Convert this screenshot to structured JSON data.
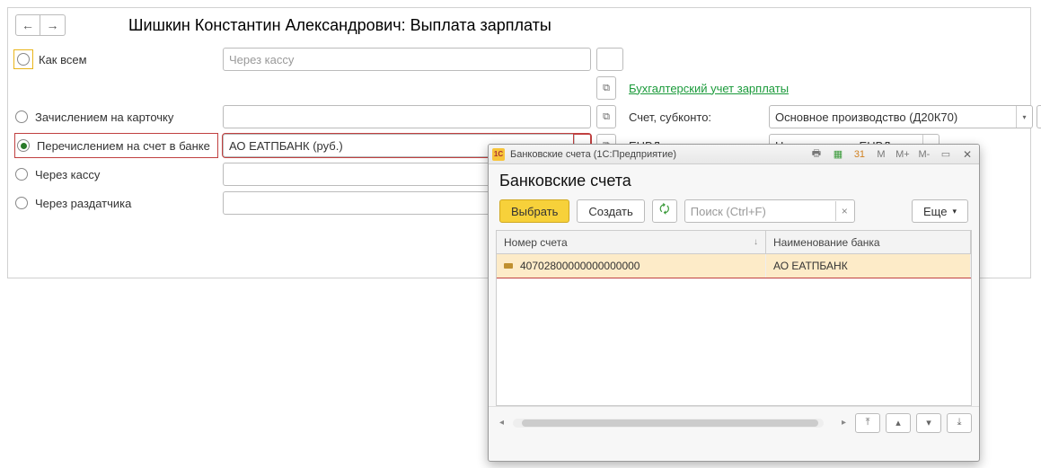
{
  "header": {
    "title": "Шишкин Константин Александрович: Выплата зарплаты"
  },
  "payment_options": [
    {
      "label": "Как всем",
      "selected": false,
      "highlight": true
    },
    {
      "label": "Зачислением на карточку",
      "selected": false
    },
    {
      "label": "Перечислением на счет в банке",
      "selected": true,
      "bank_row": true
    },
    {
      "label": "Через кассу",
      "selected": false
    },
    {
      "label": "Через раздатчика",
      "selected": false
    }
  ],
  "fields": {
    "through_cashier_placeholder": "Через кассу",
    "bank_value": "АО ЕАТПБАНК (руб.)"
  },
  "right_panel": {
    "link": "Бухгалтерский учет зарплаты",
    "account_label": "Счет, субконто:",
    "account_value": "Основное производство (Д20К70)",
    "envd_label": "ЕНВД:",
    "envd_value": "Не относится к ЕНВД"
  },
  "popup": {
    "titlebar": "Банковские счета  (1С:Предприятие)",
    "heading": "Банковские счета",
    "buttons": {
      "select": "Выбрать",
      "create": "Создать",
      "more": "Еще"
    },
    "search_placeholder": "Поиск (Ctrl+F)",
    "columns": {
      "number": "Номер счета",
      "bank": "Наименование банка"
    },
    "rows": [
      {
        "number": "40702800000000000000",
        "bank": "АО ЕАТПБАНК",
        "selected": true
      }
    ],
    "titlebar_m": {
      "m": "M",
      "mplus": "M+",
      "mminus": "M-"
    }
  }
}
